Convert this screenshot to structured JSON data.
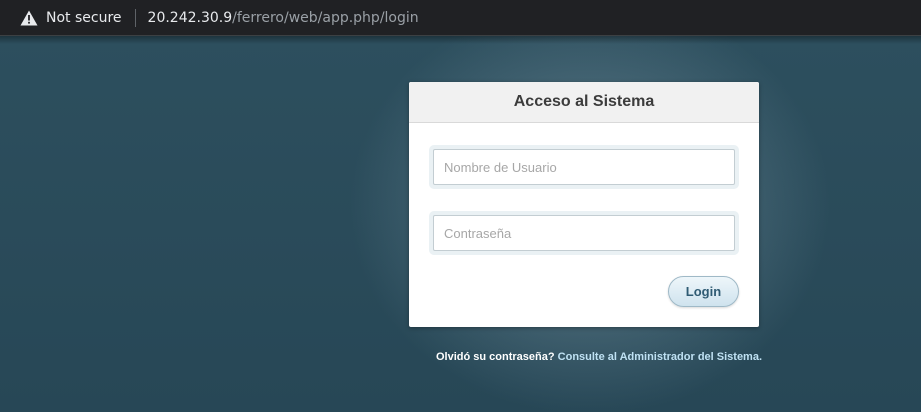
{
  "browser": {
    "security_label": "Not secure",
    "url_host": "20.242.30.9",
    "url_path": "/ferrero/web/app.php/login"
  },
  "login": {
    "title": "Acceso al Sistema",
    "username_placeholder": "Nombre de Usuario",
    "username_value": "",
    "password_placeholder": "Contraseña",
    "password_value": "",
    "submit_label": "Login"
  },
  "footer": {
    "forgot_text": "Olvidó su contraseña?",
    "forgot_link": "Consulte al Administrador del Sistema."
  },
  "colors": {
    "background": "#2b4c5b",
    "panel": "#ffffff",
    "button": "#cfe3ee",
    "link": "#bfe1f3"
  }
}
